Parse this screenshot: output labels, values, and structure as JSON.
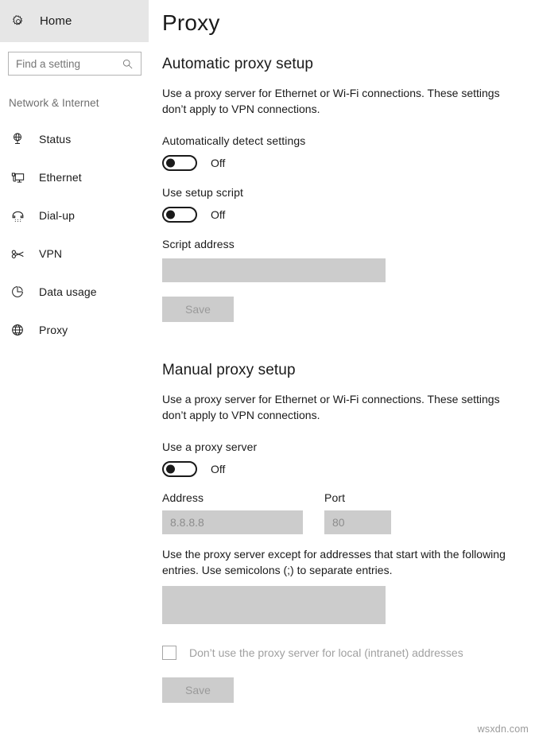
{
  "sidebar": {
    "home": {
      "label": "Home",
      "icon": "gear-icon"
    },
    "search": {
      "placeholder": "Find a setting",
      "value": "",
      "icon": "search-icon"
    },
    "heading": "Network & Internet",
    "items": [
      {
        "label": "Status",
        "icon": "network-status-icon"
      },
      {
        "label": "Ethernet",
        "icon": "ethernet-monitor-icon"
      },
      {
        "label": "Dial-up",
        "icon": "dialup-phone-icon"
      },
      {
        "label": "VPN",
        "icon": "vpn-key-icon"
      },
      {
        "label": "Data usage",
        "icon": "pie-chart-icon"
      },
      {
        "label": "Proxy",
        "icon": "globe-icon"
      }
    ]
  },
  "main": {
    "page_title": "Proxy",
    "automatic": {
      "title": "Automatic proxy setup",
      "description": "Use a proxy server for Ethernet or Wi-Fi connections. These settings don’t apply to VPN connections.",
      "auto_detect": {
        "label": "Automatically detect settings",
        "state": "Off"
      },
      "setup_script": {
        "label": "Use setup script",
        "state": "Off"
      },
      "script_address": {
        "label": "Script address",
        "value": "",
        "placeholder": ""
      },
      "save_label": "Save"
    },
    "manual": {
      "title": "Manual proxy setup",
      "description": "Use a proxy server for Ethernet or Wi-Fi connections. These settings don’t apply to VPN connections.",
      "use_proxy": {
        "label": "Use a proxy server",
        "state": "Off"
      },
      "address": {
        "label": "Address",
        "value": "",
        "placeholder": "8.8.8.8"
      },
      "port": {
        "label": "Port",
        "value": "",
        "placeholder": "80"
      },
      "exceptions_description": "Use the proxy server except for addresses that start with the following entries. Use semicolons (;) to separate entries.",
      "exceptions": {
        "value": "",
        "placeholder": ""
      },
      "local_bypass": {
        "label": "Don’t use the proxy server for local (intranet) addresses",
        "checked": false
      },
      "save_label": "Save"
    }
  },
  "watermark": "wsxdn.com",
  "colors": {
    "home_highlight": "#e6e6e6",
    "disabled_field": "#cccccc",
    "disabled_text": "#9a9a9a",
    "muted_text": "#6e6e6e"
  }
}
